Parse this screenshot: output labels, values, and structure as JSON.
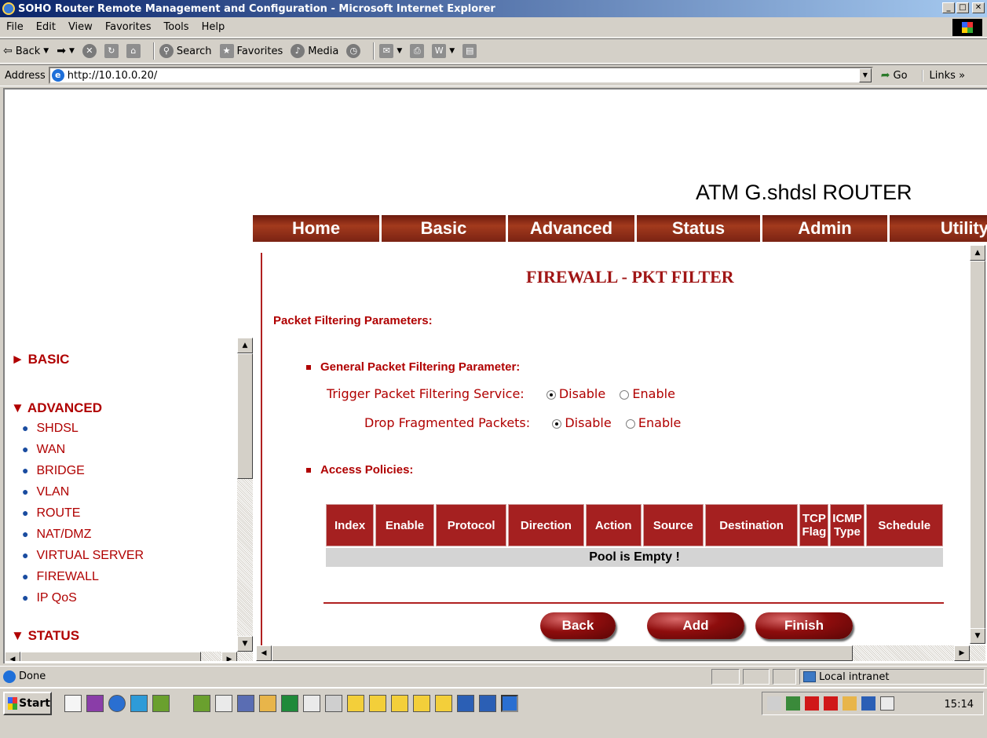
{
  "window": {
    "title": "SOHO Router Remote Management and Configuration - Microsoft Internet Explorer"
  },
  "menu": [
    "File",
    "Edit",
    "View",
    "Favorites",
    "Tools",
    "Help"
  ],
  "toolbar": {
    "back": "Back",
    "search": "Search",
    "favorites": "Favorites",
    "media": "Media"
  },
  "address": {
    "label": "Address",
    "url": "http://10.10.0.20/",
    "go": "Go",
    "links": "Links"
  },
  "brand": "ATM G.shdsl ROUTER",
  "nav": [
    "Home",
    "Basic",
    "Advanced",
    "Status",
    "Admin",
    "Utility"
  ],
  "sidebar": {
    "basic": "BASIC",
    "advanced": "ADVANCED",
    "advanced_items": [
      "SHDSL",
      "WAN",
      "BRIDGE",
      "VLAN",
      "ROUTE",
      "NAT/DMZ",
      "VIRTUAL SERVER",
      "FIREWALL",
      "IP QoS"
    ],
    "status": "STATUS"
  },
  "main": {
    "title": "FIREWALL - PKT FILTER",
    "section": "Packet Filtering Parameters:",
    "general": "General Packet Filtering Parameter:",
    "trigger": {
      "label": "Trigger Packet Filtering Service:",
      "opt1": "Disable",
      "opt2": "Enable",
      "selected": "Disable"
    },
    "drop": {
      "label": "Drop Fragmented Packets:",
      "opt1": "Disable",
      "opt2": "Enable",
      "selected": "Disable"
    },
    "policies": "Access Policies:",
    "columns": [
      "Index",
      "Enable",
      "Protocol",
      "Direction",
      "Action",
      "Source",
      "Destination",
      "TCP Flag",
      "ICMP Type",
      "Schedule"
    ],
    "empty": "Pool is Empty !",
    "buttons": {
      "back": "Back",
      "add": "Add",
      "finish": "Finish"
    }
  },
  "status": {
    "text": "Done",
    "zone": "Local intranet"
  },
  "taskbar": {
    "start": "Start",
    "time": "15:14"
  }
}
